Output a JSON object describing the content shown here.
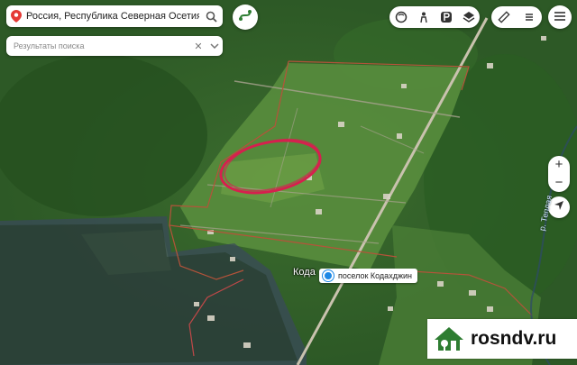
{
  "search": {
    "query": "Россия, Республика Северная Осетия — Ал",
    "results_label": "Результаты поиска"
  },
  "map": {
    "place_label": "поселок Кодахджин",
    "partial_town": "Кода",
    "river_label": "р. Теплая"
  },
  "controls": {
    "zoom_in": "+",
    "zoom_out": "−",
    "results_up": "∧",
    "results_close": "✕"
  },
  "watermark": {
    "text": "rosndv.ru"
  },
  "colors": {
    "circle": "#d6204e",
    "boundary": "#b5533a",
    "location_dot": "#1e88e5",
    "watermark_logo": "#2e7d32"
  },
  "icons": [
    "map-pin-icon",
    "search-icon",
    "route-icon",
    "layers-icon",
    "panorama-icon",
    "parking-icon",
    "stack-icon",
    "ruler-icon",
    "menu-icon",
    "locate-icon"
  ]
}
